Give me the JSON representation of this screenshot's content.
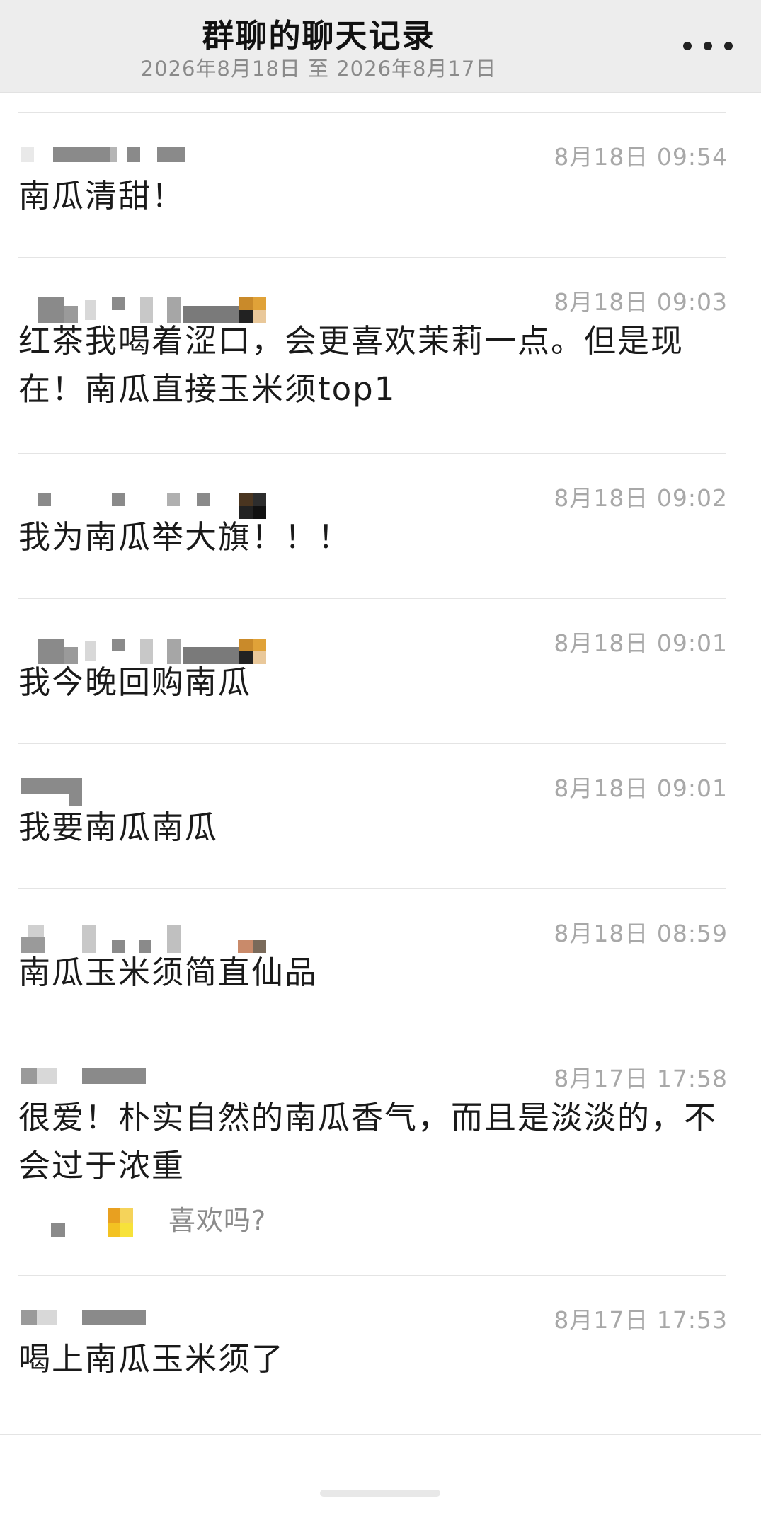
{
  "header": {
    "title": "群聊的聊天记录",
    "date_range": "2026年8月18日 至 2026年8月17日",
    "more_icon": "more-dots-icon"
  },
  "messages": [
    {
      "time": "8月18日 09:54",
      "text": "南瓜清甜！"
    },
    {
      "time": "8月18日 09:03",
      "text": "红茶我喝着涩口，会更喜欢茉莉一点。但是现在！南瓜直接玉米须top1"
    },
    {
      "time": "8月18日 09:02",
      "text": "我为南瓜举大旗！！！"
    },
    {
      "time": "8月18日 09:01",
      "text": "我今晚回购南瓜"
    },
    {
      "time": "8月18日 09:01",
      "text": "我要南瓜南瓜"
    },
    {
      "time": "8月18日 08:59",
      "text": "南瓜玉米须简直仙品"
    },
    {
      "time": "8月17日 17:58",
      "text": "很爱！朴实自然的南瓜香气，而且是淡淡的，不会过于浓重",
      "quote": "喜欢吗?"
    },
    {
      "time": "8月17日 17:53",
      "text": "喝上南瓜玉米须了"
    }
  ],
  "colors": {
    "header_bg": "#ededed",
    "time_text": "#a8a8a8",
    "divider": "#e4e4e4"
  }
}
